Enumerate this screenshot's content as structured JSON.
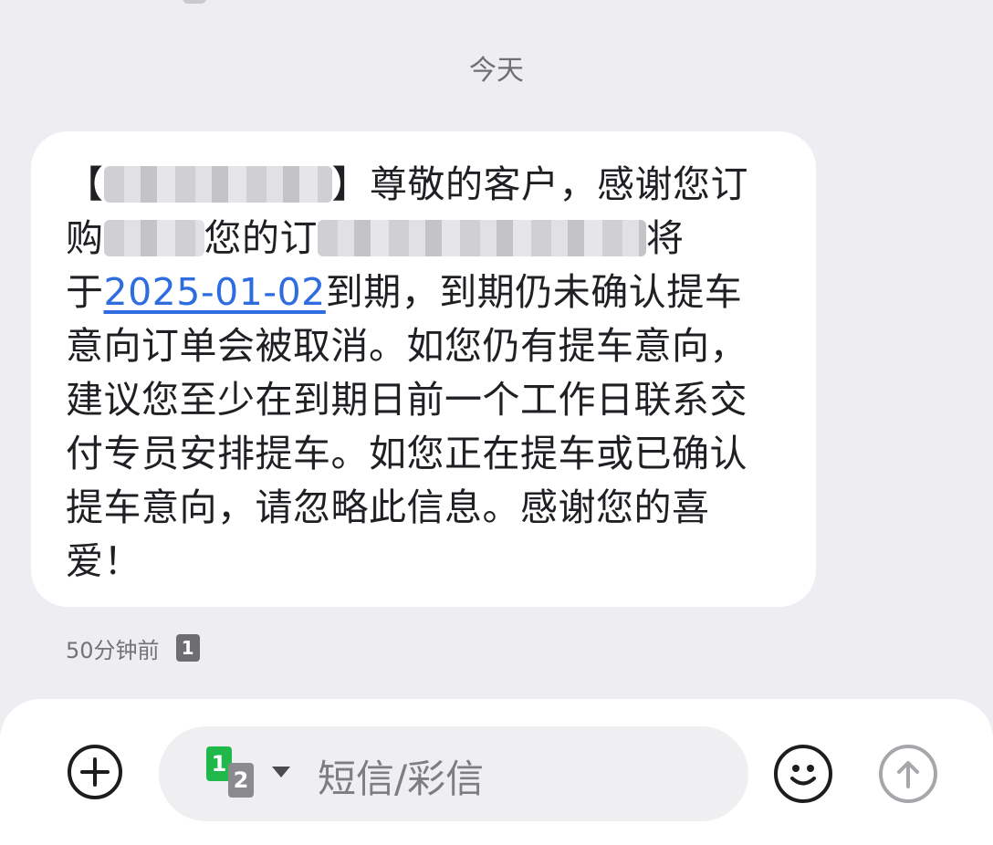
{
  "thread": {
    "date_separator": "今天"
  },
  "message": {
    "line1_tail": "尊敬的客户，感谢您订",
    "line2_start": "购",
    "line2_mid": "您的订",
    "line2_end": "将",
    "line3_start": "于",
    "due_date": "2025-01-02",
    "line3_end": "到期，到期仍未确认提",
    "body_rest": "车意向订单会被取消。如您仍有提车意向，建议您至少在到期日前一个工作日联系交付专员安排提车。如您正在提车或已确认提车意向，请忽略此信息。感谢您的喜爱！",
    "timestamp": "50分钟前",
    "sim_label": "1"
  },
  "composer": {
    "add_icon": "plus-icon",
    "sim_primary": "1",
    "sim_secondary": "2",
    "placeholder": "短信/彩信",
    "emoji_icon": "smiley-icon",
    "send_icon": "arrow-up-icon"
  },
  "colors": {
    "link": "#2e6de0",
    "sim_green": "#20b84a"
  }
}
